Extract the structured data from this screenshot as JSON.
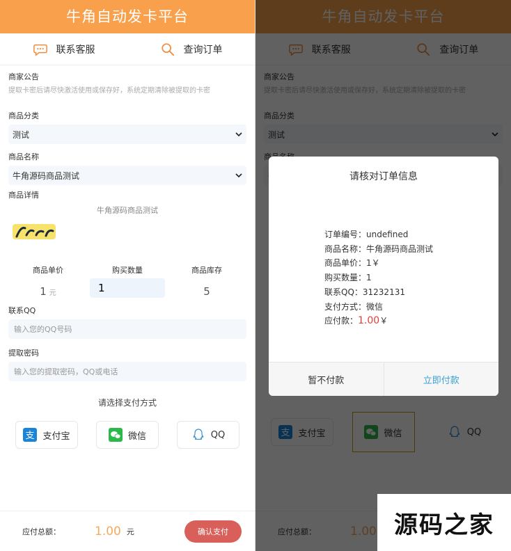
{
  "app": {
    "title": "牛角自动发卡平台"
  },
  "nav": {
    "service": "联系客服",
    "query": "查询订单"
  },
  "notice": {
    "label": "商家公告",
    "text": "提取卡密后请尽快激活使用或保存好，系统定期清除被提取的卡密"
  },
  "category": {
    "label": "商品分类",
    "value": "测试"
  },
  "product": {
    "label": "商品名称",
    "value": "牛角源码商品测试"
  },
  "detail": {
    "label": "商品详情",
    "title": "牛角源码商品测试"
  },
  "stats": {
    "price_label": "商品单价",
    "price": "1",
    "price_unit": "元",
    "qty_label": "购买数量",
    "qty": "1",
    "stock_label": "商品库存",
    "stock": "5"
  },
  "qq": {
    "label": "联系QQ",
    "placeholder": "输入您的QQ号码"
  },
  "pwd": {
    "label": "提取密码",
    "placeholder": "输入您的提取密码，QQ或电话"
  },
  "payment": {
    "title": "请选择支付方式",
    "methods": [
      "支付宝",
      "微信",
      "QQ"
    ]
  },
  "footer": {
    "label": "应付总额：",
    "amount": "1.00",
    "unit": "元",
    "confirm": "确认支付"
  },
  "modal": {
    "title": "请核对订单信息",
    "lines": [
      "订单编号：undefined",
      "商品名称：牛角源码商品测试",
      "商品单价：1￥",
      "购买数量：1",
      "联系QQ：31232131",
      "支付方式：微信"
    ],
    "total_label": "应付款：",
    "total": "1.00",
    "total_unit": "￥",
    "cancel": "暂不付款",
    "ok": "立即付款"
  },
  "watermark": {
    "text": "源码之家"
  },
  "colors": {
    "accent": "#f8a04b",
    "confirm": "#d9605a",
    "link": "#3aa0d8",
    "price": "#e0403a"
  }
}
